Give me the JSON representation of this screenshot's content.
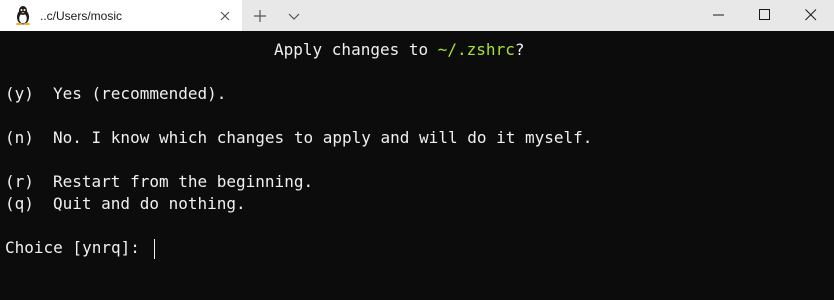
{
  "tab": {
    "title": "..c/Users/mosic",
    "icon": "linux-penguin-icon"
  },
  "titlebar": {
    "new_tab_icon": "plus-icon",
    "dropdown_icon": "chevron-down-icon",
    "minimize_icon": "minimize-icon",
    "maximize_icon": "maximize-icon",
    "close_icon": "close-icon"
  },
  "terminal": {
    "header_prefix": "Apply changes to ",
    "header_path": "~/.zshrc",
    "header_suffix": "?",
    "options": [
      {
        "key": "(y)",
        "text": "Yes (recommended)."
      },
      {
        "key": "(n)",
        "text": "No. I know which changes to apply and will do it myself."
      },
      {
        "key": "(r)",
        "text": "Restart from the beginning."
      },
      {
        "key": "(q)",
        "text": "Quit and do nothing."
      }
    ],
    "prompt": "Choice [ynrq]: "
  },
  "colors": {
    "background": "#0c0c0c",
    "foreground": "#f0f0f0",
    "path_highlight": "#a6e22e",
    "titlebar": "#e8e8e8",
    "active_tab": "#ffffff"
  }
}
